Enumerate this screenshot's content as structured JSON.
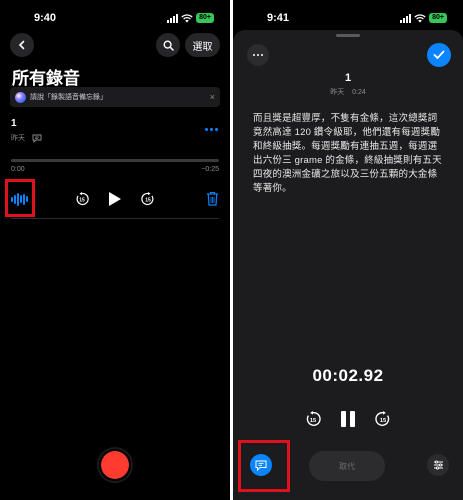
{
  "left": {
    "status": {
      "time": "9:40",
      "battery": "80+"
    },
    "toolbar": {
      "back_icon": "chevron-left-icon",
      "search_icon": "search-icon",
      "select_label": "選取"
    },
    "title": "所有錄音",
    "siri_tip": {
      "icon": "siri-icon",
      "text": "請說「錄製語音備忘錄」",
      "close": "×"
    },
    "recording": {
      "title": "1",
      "date": "昨天",
      "transcript_badge": "transcript-icon",
      "more_icon": "ellipsis-icon"
    },
    "playback": {
      "elapsed": "0:00",
      "remaining": "−0:25",
      "skip_back": "15",
      "skip_forward": "15"
    },
    "colors": {
      "accent": "#0a84ff",
      "record": "#ff3b30",
      "highlight": "#e0101d"
    }
  },
  "right": {
    "status": {
      "time": "9:41",
      "battery": "80+"
    },
    "recording": {
      "title": "1",
      "date": "昨天",
      "duration": "0:24"
    },
    "transcript": "而且獎是超豐厚，不隻有金條，這次總獎詞竟然高達 120 鑽令級耶，他們還有每週獎勵和終級抽獎。每週獎勵有連抽五週，每週選出六份三 grame 的金條，終級抽獎則有五天四夜的澳洲金礦之旅以及三份五顆的大金條等著你。",
    "timer": "00:02.92",
    "controls": {
      "skip_back": "15",
      "skip_forward": "15",
      "replace_label": "取代"
    },
    "colors": {
      "accent": "#0a84ff",
      "highlight": "#e0101d"
    }
  }
}
